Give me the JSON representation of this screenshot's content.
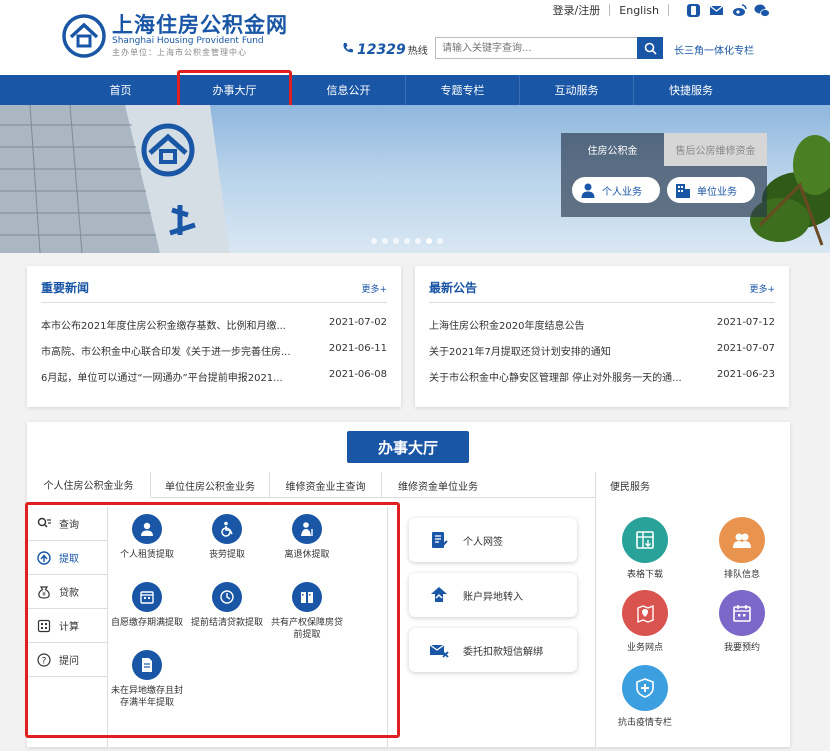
{
  "header": {
    "logo_cn": "上海住房公积金网",
    "logo_en": "Shanghai Housing Provident Fund",
    "logo_sub": "主办单位：上海市公积金管理中心",
    "login": "登录/注册",
    "english": "English",
    "hotline_num": "12329",
    "hotline_label": "热线",
    "search_placeholder": "请输入关键字查询...",
    "delta_link": "长三角一体化专栏"
  },
  "nav": {
    "items": [
      "首页",
      "办事大厅",
      "信息公开",
      "专题专栏",
      "互动服务",
      "快捷服务"
    ]
  },
  "banner": {
    "tabs": [
      "住房公积金",
      "售后公房维修资金"
    ],
    "buttons": [
      "个人业务",
      "单位业务"
    ]
  },
  "news": {
    "title": "重要新闻",
    "more": "更多+",
    "items": [
      {
        "text": "本市公布2021年度住房公积金缴存基数、比例和月缴...",
        "date": "2021-07-02"
      },
      {
        "text": "市高院、市公积金中心联合印发《关于进一步完善住房...",
        "date": "2021-06-11"
      },
      {
        "text": "6月起，单位可以通过“一网通办”平台提前申报2021...",
        "date": "2021-06-08"
      }
    ]
  },
  "notices": {
    "title": "最新公告",
    "more": "更多+",
    "items": [
      {
        "text": "上海住房公积金2020年度结息公告",
        "date": "2021-07-12"
      },
      {
        "text": "关于2021年7月提取还贷计划安排的通知",
        "date": "2021-07-07"
      },
      {
        "text": "关于市公积金中心静安区管理部 停止对外服务一天的通...",
        "date": "2021-06-23"
      }
    ]
  },
  "hall": {
    "title": "办事大厅",
    "tabs": [
      "个人住房公积金业务",
      "单位住房公积金业务",
      "维修资金业主查询",
      "维修资金单位业务"
    ],
    "convenience_label": "便民服务",
    "menu": [
      "查询",
      "提取",
      "贷款",
      "计算",
      "提问"
    ],
    "services": [
      "个人租赁提取",
      "丧劳提取",
      "离退休提取",
      "自愿缴存期满提取",
      "提前结清贷款提取",
      "共有产权保障房贷前提取",
      "未在异地缴存且封存满半年提取"
    ],
    "big_buttons": [
      "个人网签",
      "账户异地转入",
      "委托扣款短信解绑"
    ],
    "convenience": [
      "表格下载",
      "排队信息",
      "业务网点",
      "我要预约",
      "抗击疫情专栏"
    ]
  },
  "colors": {
    "primary": "#1a56a6",
    "highlight": "#e02020",
    "teal": "#29a39a",
    "orange": "#e8944f",
    "red": "#d9534f",
    "purple": "#7b68c8",
    "sky": "#3ca0e0"
  }
}
